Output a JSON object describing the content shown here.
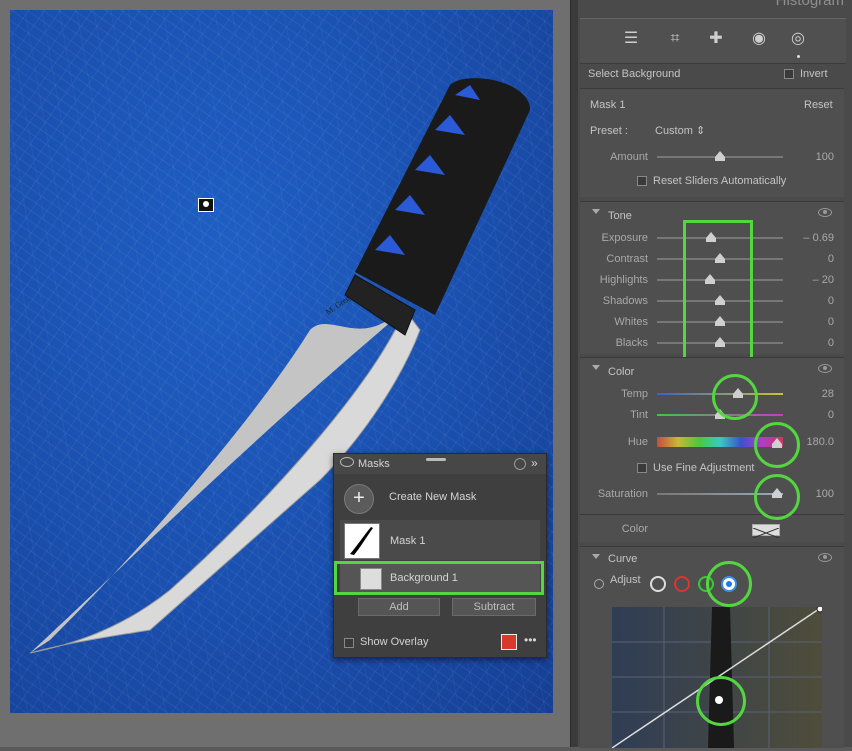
{
  "header": {
    "title": "Histogram"
  },
  "toolbar": {
    "tools": [
      "sliders-icon",
      "crop-icon",
      "heal-icon",
      "redeye-icon",
      "mask-icon"
    ]
  },
  "mask_bar": {
    "label": "Select Background",
    "invert_label": "Invert"
  },
  "mask_section": {
    "name": "Mask 1",
    "reset_label": "Reset",
    "preset_label": "Preset :",
    "preset_value": "Custom ⇕",
    "amount_label": "Amount",
    "amount_value": "100",
    "amount_level": 0.5,
    "reset_sliders_label": "Reset Sliders Automatically"
  },
  "tone": {
    "title": "Tone",
    "sliders": [
      {
        "label": "Exposure",
        "value": "– 0.69",
        "level": 0.43
      },
      {
        "label": "Contrast",
        "value": "0",
        "level": 0.5
      },
      {
        "label": "Highlights",
        "value": "– 20",
        "level": 0.42
      },
      {
        "label": "Shadows",
        "value": "0",
        "level": 0.5
      },
      {
        "label": "Whites",
        "value": "0",
        "level": 0.5
      },
      {
        "label": "Blacks",
        "value": "0",
        "level": 0.5
      }
    ]
  },
  "color": {
    "title": "Color",
    "temp_label": "Temp",
    "temp_value": "28",
    "temp_level": 0.64,
    "tint_label": "Tint",
    "tint_value": "0",
    "tint_level": 0.5,
    "hue_label": "Hue",
    "hue_value": "180.0",
    "hue_level": 0.95,
    "fine_label": "Use Fine Adjustment",
    "sat_label": "Saturation",
    "sat_value": "100",
    "sat_level": 0.95,
    "color_label": "Color"
  },
  "curve": {
    "title": "Curve",
    "adjust_label": "Adjust"
  },
  "masks_panel": {
    "title": "Masks",
    "create_label": "Create New Mask",
    "mask_name": "Mask 1",
    "component_name": "Background 1",
    "add_label": "Add",
    "subtract_label": "Subtract",
    "overlay_label": "Show Overlay",
    "overlay_color": "#d9382c"
  },
  "photo": {
    "engraving": "M. Gregory"
  },
  "colors": {
    "highlight": "#53d63f",
    "background_blue": "#1a4fae"
  }
}
